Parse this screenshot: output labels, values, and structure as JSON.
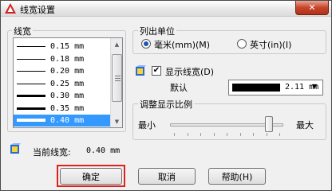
{
  "window": {
    "title": "线宽设置",
    "close_glyph": "✕"
  },
  "lineweights": {
    "group_label": "线宽",
    "items": [
      {
        "label": "0.15 mm",
        "thickness": 1
      },
      {
        "label": "0.18 mm",
        "thickness": 1
      },
      {
        "label": "0.20 mm",
        "thickness": 1
      },
      {
        "label": "0.25 mm",
        "thickness": 1
      },
      {
        "label": "0.30 mm",
        "thickness": 3
      },
      {
        "label": "0.35 mm",
        "thickness": 3
      },
      {
        "label": "0.40 mm",
        "thickness": 4
      }
    ],
    "selected_index": 6,
    "scroll_up": "▲",
    "scroll_down": "▼"
  },
  "units": {
    "group_label": "列出单位",
    "millimeters_label": "毫米(mm)(M)",
    "inches_label": "英寸(in)(I)",
    "selected": "millimeters"
  },
  "display": {
    "show_lineweight_label": "显示线宽(D)",
    "show_lineweight_checked": true,
    "check_glyph": "✔",
    "default_label": "默认",
    "default_value": "2.11 mm",
    "dropdown_glyph": "▼"
  },
  "scale": {
    "group_label": "调整显示比例",
    "min_label": "最小",
    "max_label": "最大",
    "level": 0.9
  },
  "current": {
    "label": "当前线宽:",
    "value": "0.40 mm"
  },
  "buttons": {
    "ok": "确定",
    "cancel": "取消",
    "help": "帮助(H)"
  },
  "colors": {
    "selection": "#3399ff",
    "highlight_border": "#e0201c",
    "close_button": "#c7452b"
  }
}
